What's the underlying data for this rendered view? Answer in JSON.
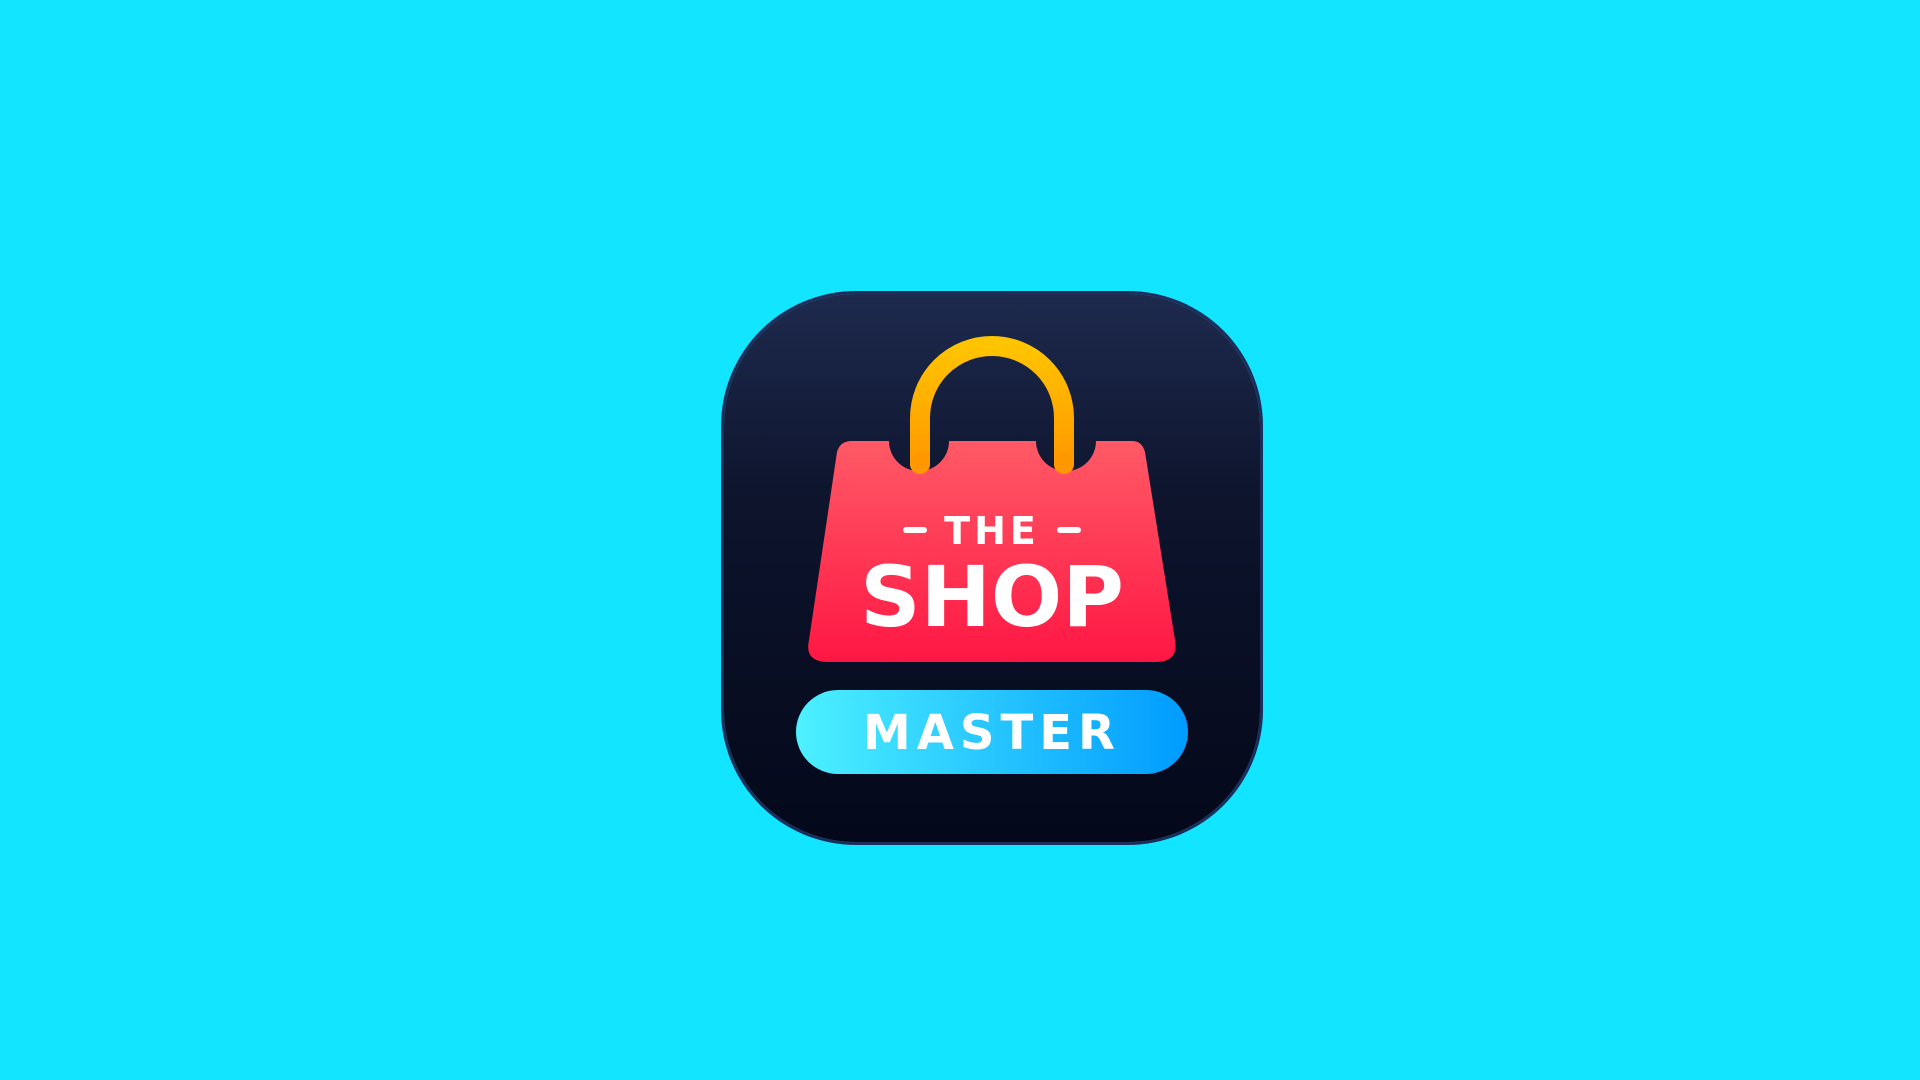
{
  "logo": {
    "line1": "THE",
    "line2": "SHOP",
    "badge": "MASTER",
    "icon_name": "shopping-bag-icon"
  },
  "colors": {
    "background": "#12e5ff",
    "icon_bg_top": "#1e2a4e",
    "icon_bg_bottom": "#04081a",
    "bag_top": "#ff5a66",
    "bag_bottom": "#ff1744",
    "handle": "#ffb300",
    "badge_left": "#4df1ff",
    "badge_right": "#009bff",
    "text": "#ffffff"
  }
}
